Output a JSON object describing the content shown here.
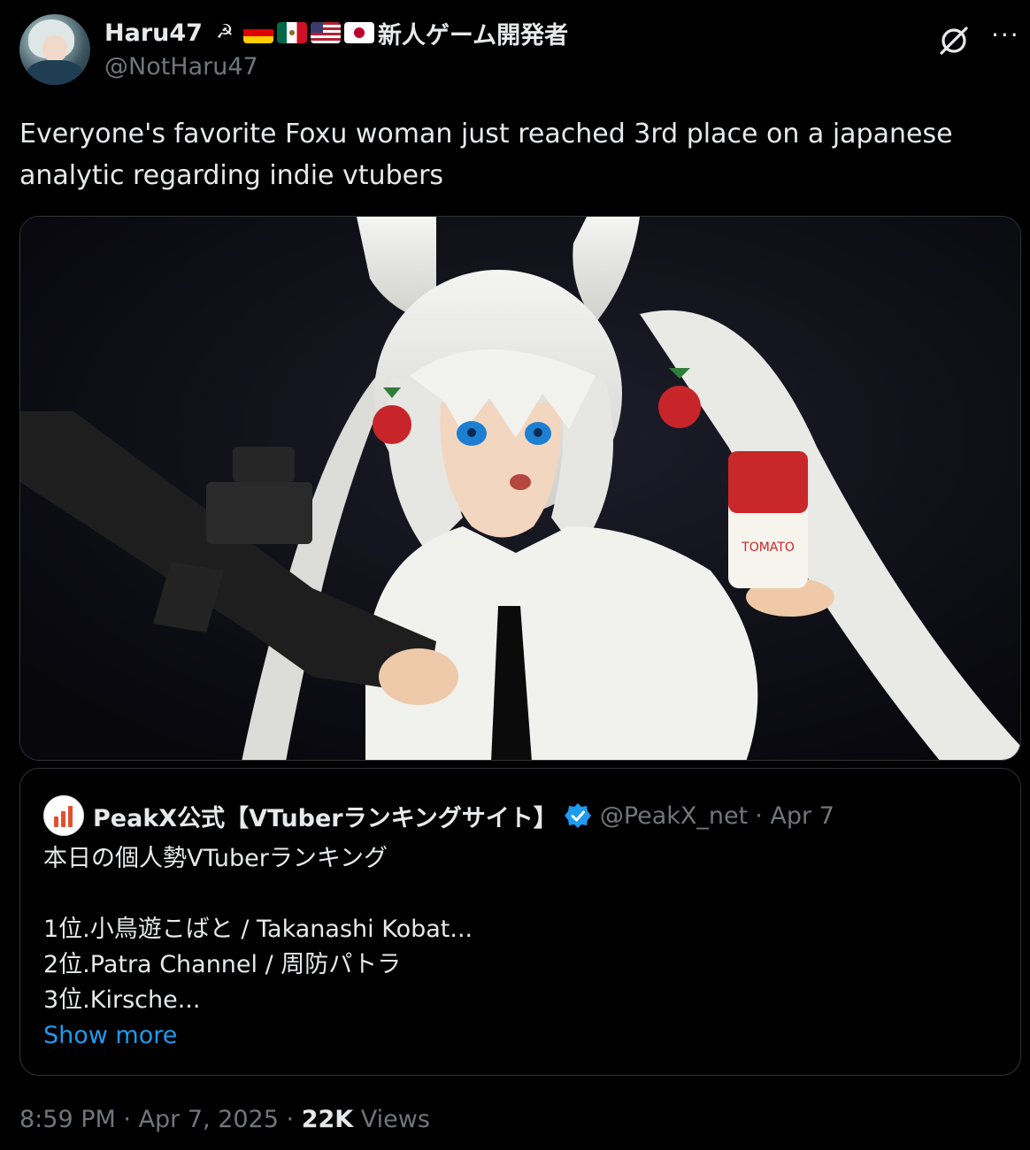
{
  "author": {
    "display_name": "Haru47",
    "name_suffix": "新人ゲーム開発者",
    "handle": "@NotHaru47",
    "name_emojis": [
      "symbol-icon",
      "germany-flag-icon",
      "mexico-flag-icon",
      "usa-flag-icon",
      "japan-flag-icon"
    ]
  },
  "actions": {
    "grok_icon": "grok-icon",
    "more_icon": "more-icon",
    "more_label": "···"
  },
  "tweet": {
    "text_line1": "Everyone's favorite Foxu woman just reached 3rd place on a japanese",
    "text_line2": "analytic regarding indie vtubers"
  },
  "media": {
    "type": "photo",
    "can_label": "TOMATO"
  },
  "quote": {
    "name": "PeakX公式【VTuberランキングサイト】",
    "handle": "@PeakX_net",
    "date": "· Apr 7",
    "verified": true,
    "lines": [
      "本日の個人勢VTuberランキング",
      "",
      "1位.小鳥遊こばと / Takanashi Kobat...",
      "2位.Patra Channel / 周防パトラ",
      "3位.Kirsche..."
    ],
    "show_more": "Show more"
  },
  "meta": {
    "time": "8:59 PM",
    "date": "Apr 7, 2025",
    "views_count": "22K",
    "views_label": "Views"
  },
  "colors": {
    "background": "#000000",
    "text": "#e7e9ea",
    "secondary": "#71767b",
    "link": "#1d9bf0",
    "border": "#2f3336",
    "verified": "#1d9bf0"
  }
}
